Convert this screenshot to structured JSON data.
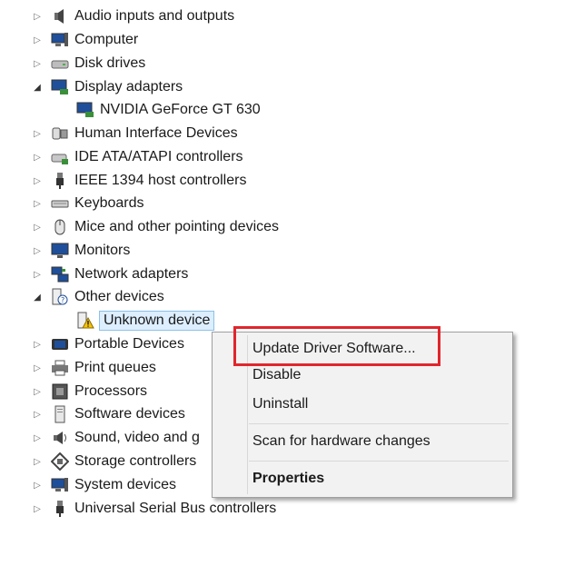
{
  "tree": {
    "categories": [
      {
        "label": "Audio inputs and outputs",
        "icon": "speaker-icon",
        "state": "collapsed"
      },
      {
        "label": "Computer",
        "icon": "computer-icon",
        "state": "collapsed"
      },
      {
        "label": "Disk drives",
        "icon": "disk-drive-icon",
        "state": "collapsed"
      },
      {
        "label": "Display adapters",
        "icon": "display-adapter-icon",
        "state": "expanded"
      },
      {
        "label": "NVIDIA GeForce GT 630",
        "icon": "display-adapter-icon",
        "state": "child"
      },
      {
        "label": "Human Interface Devices",
        "icon": "hid-icon",
        "state": "collapsed"
      },
      {
        "label": "IDE ATA/ATAPI controllers",
        "icon": "ide-controller-icon",
        "state": "collapsed"
      },
      {
        "label": "IEEE 1394 host controllers",
        "icon": "firewire-icon",
        "state": "collapsed"
      },
      {
        "label": "Keyboards",
        "icon": "keyboard-icon",
        "state": "collapsed"
      },
      {
        "label": "Mice and other pointing devices",
        "icon": "mouse-icon",
        "state": "collapsed"
      },
      {
        "label": "Monitors",
        "icon": "monitor-icon",
        "state": "collapsed"
      },
      {
        "label": "Network adapters",
        "icon": "network-icon",
        "state": "collapsed"
      },
      {
        "label": "Other devices",
        "icon": "other-devices-icon",
        "state": "expanded"
      },
      {
        "label": "Unknown device",
        "icon": "unknown-device-warning-icon",
        "state": "child-selected"
      },
      {
        "label": "Portable Devices",
        "icon": "portable-device-icon",
        "state": "collapsed"
      },
      {
        "label": "Print queues",
        "icon": "printer-icon",
        "state": "collapsed"
      },
      {
        "label": "Processors",
        "icon": "processor-icon",
        "state": "collapsed"
      },
      {
        "label": "Software devices",
        "icon": "software-device-icon",
        "state": "collapsed"
      },
      {
        "label": "Sound, video and g",
        "icon": "sound-icon",
        "state": "collapsed"
      },
      {
        "label": "Storage controllers",
        "icon": "storage-controller-icon",
        "state": "collapsed"
      },
      {
        "label": "System devices",
        "icon": "system-device-icon",
        "state": "collapsed"
      },
      {
        "label": "Universal Serial Bus controllers",
        "icon": "usb-icon",
        "state": "collapsed"
      }
    ]
  },
  "context_menu": {
    "update_driver": "Update Driver Software...",
    "disable": "Disable",
    "uninstall": "Uninstall",
    "scan": "Scan for hardware changes",
    "properties": "Properties"
  },
  "colors": {
    "highlight_border": "#e1252c",
    "selection_bg": "#ddeeff",
    "menu_bg": "#f2f2f2"
  }
}
